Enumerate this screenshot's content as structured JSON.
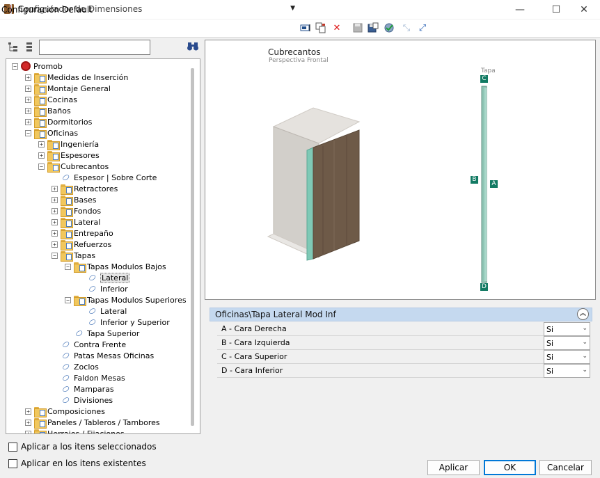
{
  "window": {
    "title": "Configurador de Dimensiones",
    "minimize_glyph": "—",
    "maximize_glyph": "☐",
    "close_glyph": "✕",
    "icon": "ruler-app-icon"
  },
  "toolbar": {
    "config_value": "Configuración Default",
    "icons": [
      "rename-icon",
      "copy-icon",
      "delete-icon",
      "save-icon",
      "save-as-icon",
      "apply-settings-icon",
      "collapse-arrows-icon",
      "expand-arrows-icon"
    ]
  },
  "search": {
    "value": "",
    "placeholder": ""
  },
  "tree": {
    "items": [
      {
        "label": "Promob",
        "kind": "root",
        "depth": 0,
        "exp": "−"
      },
      {
        "label": "Medidas de Inserción",
        "kind": "folder",
        "depth": 1,
        "exp": "+"
      },
      {
        "label": "Montaje General",
        "kind": "folder",
        "depth": 1,
        "exp": "+"
      },
      {
        "label": "Cocinas",
        "kind": "folder",
        "depth": 1,
        "exp": "+"
      },
      {
        "label": "Baños",
        "kind": "folder",
        "depth": 1,
        "exp": "+"
      },
      {
        "label": "Dormitorios",
        "kind": "folder",
        "depth": 1,
        "exp": "+"
      },
      {
        "label": "Oficinas",
        "kind": "folder",
        "depth": 1,
        "exp": "−"
      },
      {
        "label": "Ingeniería",
        "kind": "folder",
        "depth": 2,
        "exp": "+"
      },
      {
        "label": "Espesores",
        "kind": "folder",
        "depth": 2,
        "exp": "+"
      },
      {
        "label": "Cubrecantos",
        "kind": "folder",
        "depth": 2,
        "exp": "−"
      },
      {
        "label": "Espesor | Sobre Corte",
        "kind": "tag",
        "depth": 3,
        "exp": ""
      },
      {
        "label": "Retractores",
        "kind": "folder",
        "depth": 3,
        "exp": "+"
      },
      {
        "label": "Bases",
        "kind": "folder",
        "depth": 3,
        "exp": "+"
      },
      {
        "label": "Fondos",
        "kind": "folder",
        "depth": 3,
        "exp": "+"
      },
      {
        "label": "Lateral",
        "kind": "folder",
        "depth": 3,
        "exp": "+"
      },
      {
        "label": "Entrepaño",
        "kind": "folder",
        "depth": 3,
        "exp": "+"
      },
      {
        "label": "Refuerzos",
        "kind": "folder",
        "depth": 3,
        "exp": "+"
      },
      {
        "label": "Tapas",
        "kind": "folder",
        "depth": 3,
        "exp": "−"
      },
      {
        "label": "Tapas Modulos Bajos",
        "kind": "folder",
        "depth": 4,
        "exp": "−"
      },
      {
        "label": "Lateral",
        "kind": "tag",
        "depth": 5,
        "exp": "",
        "selected": true
      },
      {
        "label": "Inferior",
        "kind": "tag",
        "depth": 5,
        "exp": ""
      },
      {
        "label": "Tapas Modulos Superiores",
        "kind": "folder",
        "depth": 4,
        "exp": "−"
      },
      {
        "label": "Lateral",
        "kind": "tag",
        "depth": 5,
        "exp": ""
      },
      {
        "label": "Inferior y Superior",
        "kind": "tag",
        "depth": 5,
        "exp": ""
      },
      {
        "label": "Tapa Superior",
        "kind": "tag",
        "depth": 4,
        "exp": ""
      },
      {
        "label": "Contra Frente",
        "kind": "tag",
        "depth": 3,
        "exp": ""
      },
      {
        "label": "Patas Mesas Oficinas",
        "kind": "tag",
        "depth": 3,
        "exp": ""
      },
      {
        "label": "Zoclos",
        "kind": "tag",
        "depth": 3,
        "exp": ""
      },
      {
        "label": "Faldon Mesas",
        "kind": "tag",
        "depth": 3,
        "exp": ""
      },
      {
        "label": "Mamparas",
        "kind": "tag",
        "depth": 3,
        "exp": ""
      },
      {
        "label": "Divisiones",
        "kind": "tag",
        "depth": 3,
        "exp": ""
      },
      {
        "label": "Composiciones",
        "kind": "folder",
        "depth": 1,
        "exp": "+"
      },
      {
        "label": "Paneles / Tableros / Tambores",
        "kind": "folder",
        "depth": 1,
        "exp": "+"
      },
      {
        "label": "Herrajes / Fijaciones",
        "kind": "folder",
        "depth": 1,
        "exp": "+"
      }
    ]
  },
  "preview": {
    "title": "Cubrecantos",
    "subtitle": "Perspectiva Frontal",
    "part_label": "Tapa",
    "faces": {
      "c": "C",
      "b": "B",
      "a": "A",
      "d": "D"
    },
    "colors": {
      "edge": "#7fc9b6",
      "wood": "#6e5a48",
      "carcass": "#d6d3cf",
      "face_label": "#127a63"
    }
  },
  "props": {
    "header": "Oficinas\\Tapa Lateral Mod Inf",
    "collapse_glyph": "︽",
    "rows": [
      {
        "label": "A - Cara Derecha",
        "value": "Si"
      },
      {
        "label": "B - Cara Izquierda",
        "value": "Si"
      },
      {
        "label": "C - Cara Superior",
        "value": "Si"
      },
      {
        "label": "D - Cara Inferior",
        "value": "Si"
      }
    ]
  },
  "options": {
    "apply_selected": "Aplicar a los itens seleccionados",
    "apply_existing": "Aplicar en los itens existentes"
  },
  "buttons": {
    "apply": "Aplicar",
    "ok": "OK",
    "cancel": "Cancelar"
  }
}
